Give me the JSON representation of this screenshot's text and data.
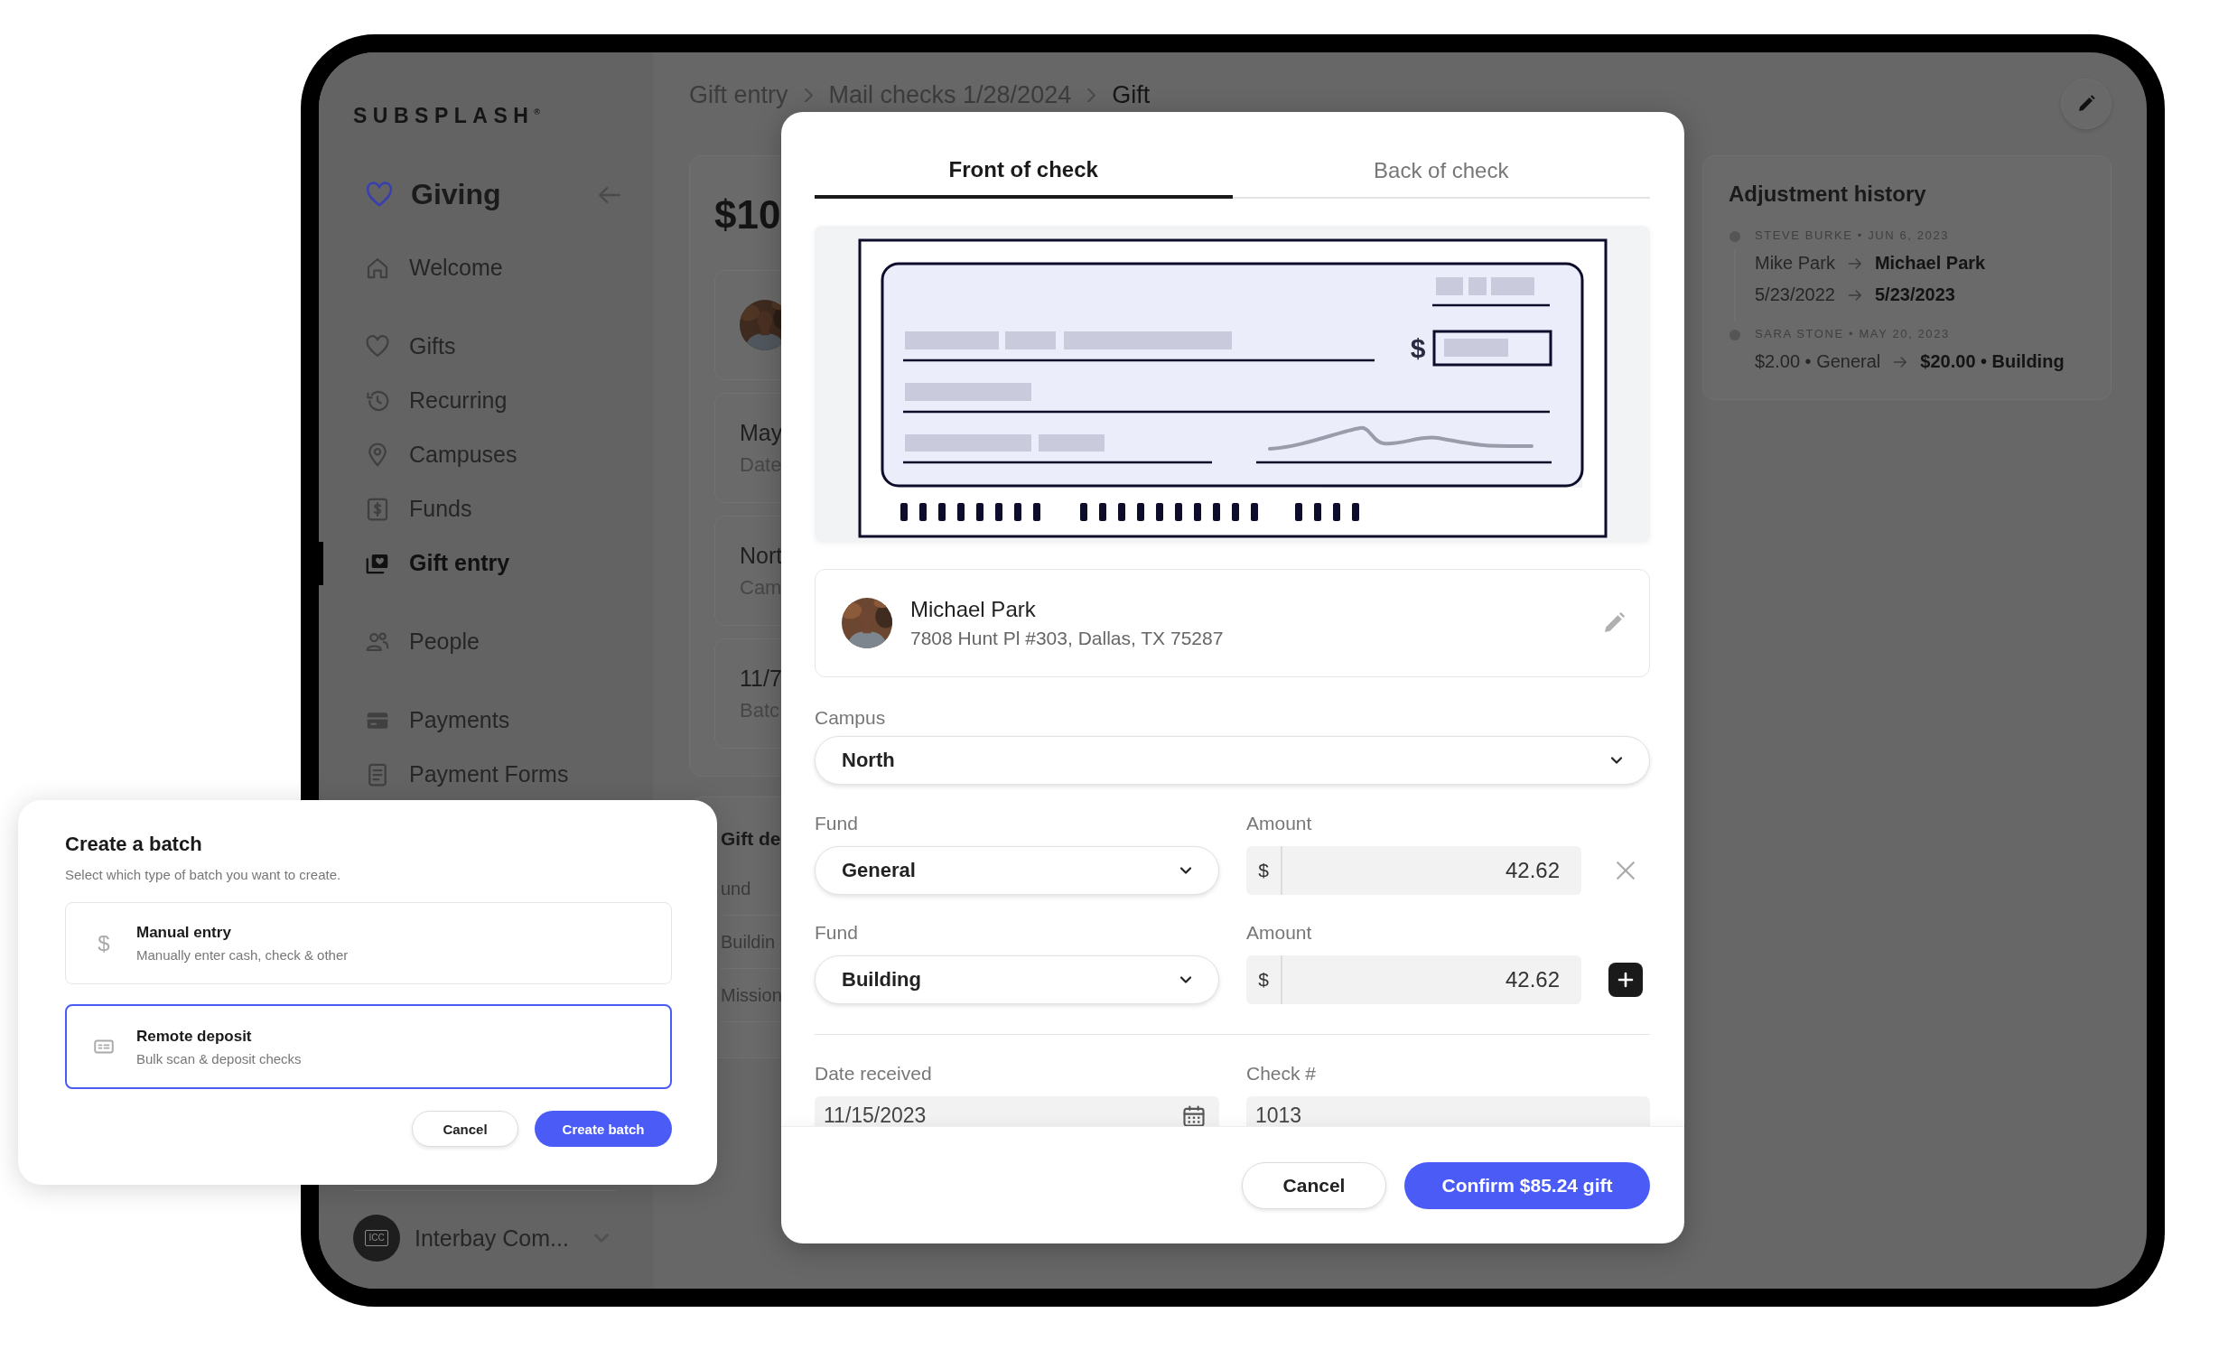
{
  "sidebar": {
    "logo": "SUBSPLASH$^{®}$",
    "section": "Giving",
    "groups": [
      {
        "items": [
          {
            "label": "Welcome",
            "selected": false
          }
        ]
      },
      {
        "items": [
          {
            "label": "Gifts",
            "selected": false
          },
          {
            "label": "Recurring",
            "selected": false
          },
          {
            "label": "Campuses",
            "selected": false
          },
          {
            "label": "Funds",
            "selected": false
          },
          {
            "label": "Gift entry",
            "selected": true
          }
        ]
      },
      {
        "items": [
          {
            "label": "People",
            "selected": false
          }
        ]
      },
      {
        "items": [
          {
            "label": "Payments",
            "selected": false
          },
          {
            "label": "Payment Forms",
            "selected": false
          }
        ]
      }
    ],
    "account": {
      "initials": "ICC",
      "name": "Interbay Com..."
    }
  },
  "breadcrumb": [
    {
      "label": "Gift entry"
    },
    {
      "label": "Mail checks 1/28/2024"
    },
    {
      "label": "Gift"
    }
  ],
  "gift_summary": {
    "amount": "$10",
    "rows": [
      {
        "kind": "picture"
      },
      {
        "kind": "text",
        "title": "May",
        "subtitle": "Date"
      },
      {
        "kind": "text",
        "title": "Nort",
        "subtitle": "Cam"
      },
      {
        "kind": "text",
        "title": "11/7",
        "subtitle": "Batc"
      }
    ]
  },
  "gift_details": {
    "title": "Gift de",
    "rows": [
      "und",
      "Buildin",
      "Mission"
    ]
  },
  "adjustment_history": {
    "title": "Adjustment history",
    "entries": [
      {
        "meta": "STEVE BURKE • JUN 6, 2023",
        "changes": [
          {
            "from": "Mike Park",
            "to": "Michael Park"
          },
          {
            "from": "5/23/2022",
            "to": "5/23/2023"
          }
        ]
      },
      {
        "meta": "SARA STONE • MAY 20, 2023",
        "changes": [
          {
            "from": "$2.00 • General",
            "to": "$20.00 • Building"
          }
        ]
      }
    ]
  },
  "modal": {
    "tabs": [
      {
        "label": "Front of check",
        "selected": true
      },
      {
        "label": "Back of check",
        "selected": false
      }
    ],
    "check_symbol": "$",
    "payer": {
      "name": "Michael Park",
      "address": "7808 Hunt Pl #303, Dallas, TX 75287"
    },
    "campus": {
      "label": "Campus",
      "value": "North"
    },
    "splits": [
      {
        "fund_label": "Fund",
        "fund": "General",
        "amount_label": "Amount",
        "currency": "$",
        "amount": "42.62",
        "kind": "remove"
      },
      {
        "fund_label": "Fund",
        "fund": "Building",
        "amount_label": "Amount",
        "currency": "$",
        "amount": "42.62",
        "kind": "add"
      }
    ],
    "date": {
      "label": "Date received",
      "value": "11/15/2023"
    },
    "check_number": {
      "label": "Check #",
      "value": "1013"
    },
    "buttons": [
      {
        "label": "Cancel",
        "kind": "secondary"
      },
      {
        "label": "Confirm $85.24 gift",
        "kind": "primary"
      }
    ]
  },
  "create_batch": {
    "title": "Create a batch",
    "subtitle": "Select which type of batch you want to create.",
    "options": [
      {
        "kind": "glyph",
        "glyph": "$",
        "title": "Manual entry",
        "description": "Manually enter cash, check & other",
        "selected": false
      },
      {
        "kind": "check",
        "title": "Remote deposit",
        "description": "Bulk scan & deposit checks",
        "selected": true
      }
    ],
    "buttons": [
      {
        "label": "Cancel",
        "kind": "secondary"
      },
      {
        "label": "Create batch",
        "kind": "primary"
      }
    ]
  }
}
